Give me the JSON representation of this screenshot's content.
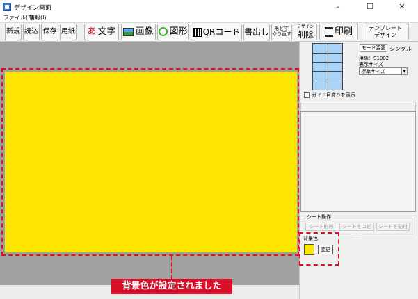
{
  "window": {
    "title": "デザイン画面",
    "min": "–",
    "max": "☐",
    "close": "✕"
  },
  "menu": [
    "ファイル(F)",
    "情報(I)"
  ],
  "toolbar": {
    "new": "新規",
    "open": "読込",
    "save": "保存",
    "paper": "用紙",
    "text": "文字",
    "text_glyph": "あ",
    "image": "画像",
    "shape": "図形",
    "qr": "QRコード",
    "export": "書出し",
    "undo": "もどす",
    "redo": "やり直す",
    "delete_top": "デザイン",
    "delete": "削除",
    "print": "印刷",
    "template_top": "テンプレート",
    "template_bottom": "デザイン"
  },
  "panel": {
    "mode_button": "モード変更",
    "mode_value": "シングル",
    "paper_info": "用紙：S1002",
    "display_size_label": "表示サイズ",
    "display_size_value": "標準サイズ",
    "guide_label": "ガイド目盛りを表示",
    "sheet_ops_label": "シート操作",
    "sheet_delete": "シート削除",
    "sheet_copy": "シートをコピー",
    "sheet_paste": "シートを貼付",
    "bg_label": "背景色",
    "bg_change": "変更"
  },
  "caption": "背景色が設定されました",
  "colors": {
    "background": "#ffe600",
    "highlight": "#d9102a"
  }
}
